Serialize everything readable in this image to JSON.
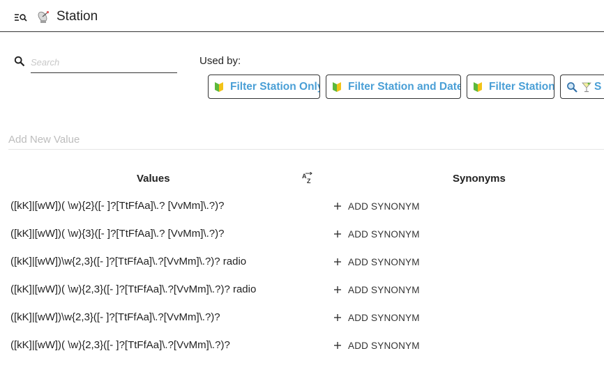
{
  "header": {
    "title": "Station",
    "menu_icon": "list-search-icon",
    "entity_icon": "satellite-dish-icon"
  },
  "search": {
    "placeholder": "Search",
    "value": ""
  },
  "used_by": {
    "label": "Used by:",
    "chips": [
      {
        "label": "Filter Station Only",
        "icon": "yellow-green-leaf-icon"
      },
      {
        "label": "Filter Station and Date",
        "icon": "yellow-green-leaf-icon"
      },
      {
        "label": "Filter Station",
        "icon": "yellow-green-leaf-icon"
      },
      {
        "label": "S",
        "icon": "magnifier-cocktail-icon"
      }
    ]
  },
  "add_value": {
    "placeholder": "Add New Value"
  },
  "table": {
    "values_header": "Values",
    "sort_icon": "sort-az-icon",
    "synonyms_header": "Synonyms",
    "add_synonym_label": "ADD SYNONYM",
    "rows": [
      {
        "value": "([kK]|[wW])( \\w){2}([- ]?[TtFfAa]\\.? [VvMm]\\.?)?"
      },
      {
        "value": "([kK]|[wW])( \\w){3}([- ]?[TtFfAa]\\.? [VvMm]\\.?)?"
      },
      {
        "value": "([kK]|[wW])\\w{2,3}([- ]?[TtFfAa]\\.?[VvMm]\\.?)? radio"
      },
      {
        "value": "([kK]|[wW])( \\w){2,3}([- ]?[TtFfAa]\\.?[VvMm]\\.?)? radio"
      },
      {
        "value": "([kK]|[wW])\\w{2,3}([- ]?[TtFfAa]\\.?[VvMm]\\.?)?"
      },
      {
        "value": "([kK]|[wW])( \\w){2,3}([- ]?[TtFfAa]\\.?[VvMm]\\.?)?"
      }
    ]
  },
  "colors": {
    "chip_text": "#4a9fd6",
    "leaf_yellow": "#f2c318",
    "leaf_green": "#5cb83c"
  }
}
